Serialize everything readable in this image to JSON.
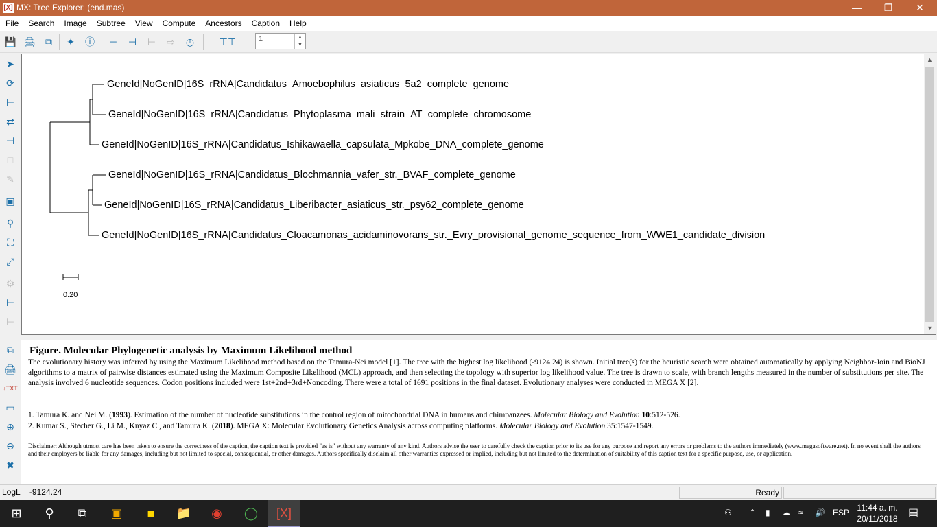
{
  "window": {
    "app_icon": "[X]",
    "title": "MX: Tree Explorer: (end.mas)"
  },
  "menu": [
    "File",
    "Search",
    "Image",
    "Subtree",
    "View",
    "Compute",
    "Ancestors",
    "Caption",
    "Help"
  ],
  "toolbar": {
    "spin_value": "1"
  },
  "tree": {
    "taxa": [
      "GeneId|NoGenID|16S_rRNA|Candidatus_Amoebophilus_asiaticus_5a2_complete_genome",
      "GeneId|NoGenID|16S_rRNA|Candidatus_Phytoplasma_mali_strain_AT_complete_chromosome",
      "GeneId|NoGenID|16S_rRNA|Candidatus_Ishikawaella_capsulata_Mpkobe_DNA_complete_genome",
      "GeneId|NoGenID|16S_rRNA|Candidatus_Blochmannia_vafer_str._BVAF_complete_genome",
      "GeneId|NoGenID|16S_rRNA|Candidatus_Liberibacter_asiaticus_str._psy62_complete_genome",
      "GeneId|NoGenID|16S_rRNA|Candidatus_Cloacamonas_acidaminovorans_str._Evry_provisional_genome_sequence_from_WWE1_candidate_division"
    ],
    "scale_bar_label": "0.20"
  },
  "caption": {
    "heading": "Figure. Molecular Phylogenetic analysis by Maximum Likelihood method",
    "body": "The evolutionary history was inferred by using the Maximum Likelihood method based on the Tamura-Nei model [1]. The tree with the highest log likelihood (-9124.24) is shown. Initial tree(s) for the heuristic search were obtained automatically by applying Neighbor-Join and BioNJ algorithms to a matrix of pairwise distances estimated using the Maximum Composite Likelihood (MCL) approach, and then selecting the topology with superior log likelihood value. The tree is drawn to scale, with branch lengths measured in the number of substitutions per site. The analysis involved 6 nucleotide sequences. Codon positions included were 1st+2nd+3rd+Noncoding. There were a total of 1691 positions in the final dataset. Evolutionary analyses were conducted in MEGA X [2].",
    "ref1": {
      "pre": "1. Tamura K. and Nei M. (",
      "year": "1993",
      "mid": "). Estimation of the number of nucleotide substitutions in the control region of mitochondrial DNA in humans and chimpanzees. ",
      "journal": "Molecular Biology and Evolution",
      "vol": " 10",
      "pages": ":512-526."
    },
    "ref2": {
      "pre": "2. Kumar S., Stecher G., Li M., Knyaz C., and Tamura K. (",
      "year": "2018",
      "mid": "). MEGA X: Molecular Evolutionary Genetics Analysis across computing platforms. ",
      "journal": "Molecular Biology and Evolution",
      "pages": " 35:1547-1549."
    },
    "disclaimer": "Disclaimer: Although utmost care has been taken to ensure the correctness of the caption, the caption text is provided \"as is\" without any warranty of any kind. Authors advise the user to carefully check the caption prior to its use for any purpose and report any errors or problems to the authors immediately (www.megasoftware.net). In no event shall the authors and their employers be liable for any damages, including but not limited to special, consequential, or other damages. Authors specifically disclaim all other warranties expressed or implied, including but not limited to the determination of suitability of this caption text for a specific purpose, use, or application."
  },
  "status": {
    "logl": "LogL = -9124.24",
    "state": "Ready"
  },
  "taskbar": {
    "language": "ESP",
    "time": "11:44 a. m.",
    "date": "20/11/2018"
  }
}
